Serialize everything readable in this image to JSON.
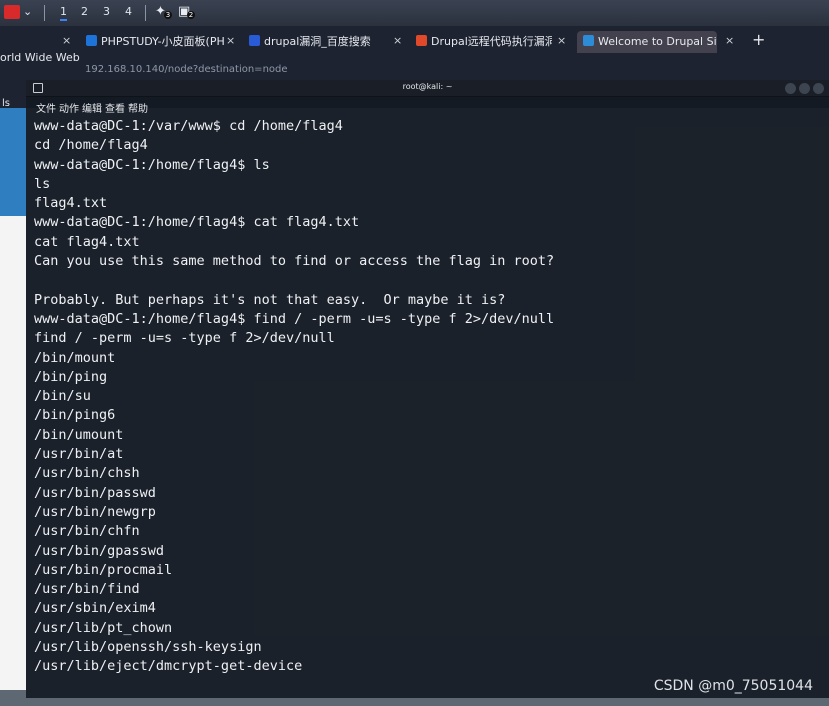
{
  "panel": {
    "workspaces": [
      "1",
      "2",
      "3",
      "4"
    ],
    "tray_badges": [
      "3",
      "2"
    ]
  },
  "browser": {
    "window_title": "orld Wide Web",
    "tabs": [
      {
        "label": "PHPSTUDY-小皮面板(PHI",
        "fav_color": "#1e73d8"
      },
      {
        "label": "drupal漏洞_百度搜索",
        "fav_color": "#2a5bd7"
      },
      {
        "label": "Drupal远程代码执行漏洞",
        "fav_color": "#e04a2b"
      },
      {
        "label": "Welcome to Drupal Site |",
        "fav_color": "#2d8cd8"
      }
    ],
    "url": "192.168.10.140/node?destination=node",
    "sidebar_text": "ls"
  },
  "terminal": {
    "title": "root@kali: ~",
    "menu": [
      "文件",
      "动作",
      "编辑",
      "查看",
      "帮助"
    ],
    "lines": [
      "www-data@DC-1:/var/www$ cd /home/flag4",
      "cd /home/flag4",
      "www-data@DC-1:/home/flag4$ ls",
      "ls",
      "flag4.txt",
      "www-data@DC-1:/home/flag4$ cat flag4.txt",
      "cat flag4.txt",
      "Can you use this same method to find or access the flag in root?",
      "",
      "Probably. But perhaps it's not that easy.  Or maybe it is?",
      "www-data@DC-1:/home/flag4$ find / -perm -u=s -type f 2>/dev/null",
      "find / -perm -u=s -type f 2>/dev/null",
      "/bin/mount",
      "/bin/ping",
      "/bin/su",
      "/bin/ping6",
      "/bin/umount",
      "/usr/bin/at",
      "/usr/bin/chsh",
      "/usr/bin/passwd",
      "/usr/bin/newgrp",
      "/usr/bin/chfn",
      "/usr/bin/gpasswd",
      "/usr/bin/procmail",
      "/usr/bin/find",
      "/usr/sbin/exim4",
      "/usr/lib/pt_chown",
      "/usr/lib/openssh/ssh-keysign",
      "/usr/lib/eject/dmcrypt-get-device"
    ]
  },
  "watermark": "CSDN @m0_75051044"
}
